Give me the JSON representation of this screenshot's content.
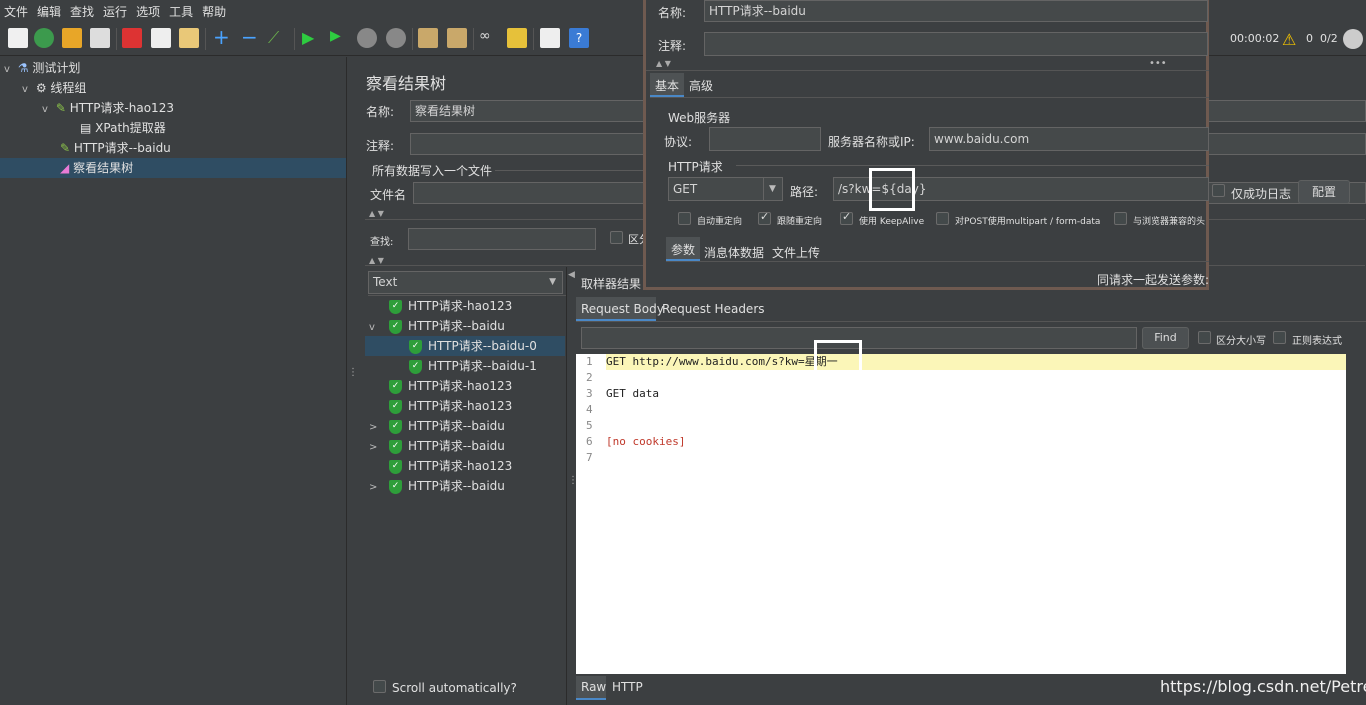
{
  "menu": [
    "文件",
    "编辑",
    "查找",
    "运行",
    "选项",
    "工具",
    "帮助"
  ],
  "status": {
    "elapsed": "00:00:02",
    "warnings": "0",
    "threads": "0/2"
  },
  "tree": {
    "items": [
      {
        "label": "测试计划",
        "icon": "flask-icon"
      },
      {
        "label": "线程组",
        "icon": "gear-icon"
      },
      {
        "label": "HTTP请求-hao123",
        "icon": "sampler-pen-icon"
      },
      {
        "label": "XPath提取器",
        "icon": "extractor-doc-icon"
      },
      {
        "label": "HTTP请求--baidu",
        "icon": "sampler-pen-icon"
      },
      {
        "label": "察看结果树",
        "icon": "chart-listener-icon"
      }
    ]
  },
  "listener": {
    "title": "察看结果树",
    "name_label": "名称:",
    "name_value": "察看结果树",
    "comment_label": "注释:",
    "file_group": "所有数据写入一个文件",
    "file_label": "文件名",
    "search_label": "查找:",
    "case_label": "区分",
    "renderer": "Text",
    "sampler_result_tab": "取样器结果",
    "scroll_auto": "Scroll automatically?"
  },
  "results": [
    {
      "label": "HTTP请求-hao123",
      "chev": ""
    },
    {
      "label": "HTTP请求--baidu",
      "chev": "v"
    },
    {
      "label": "HTTP请求--baidu-0",
      "chev": ""
    },
    {
      "label": "HTTP请求--baidu-1",
      "chev": ""
    },
    {
      "label": "HTTP请求-hao123",
      "chev": ""
    },
    {
      "label": "HTTP请求-hao123",
      "chev": ""
    },
    {
      "label": "HTTP请求--baidu",
      "chev": ">"
    },
    {
      "label": "HTTP请求--baidu",
      "chev": ">"
    },
    {
      "label": "HTTP请求-hao123",
      "chev": ""
    },
    {
      "label": "HTTP请求--baidu",
      "chev": ">"
    }
  ],
  "request_panel": {
    "tabs": [
      "Request Body",
      "Request Headers"
    ],
    "find_button": "Find",
    "case_label": "区分大小写",
    "regex_label": "正则表达式",
    "line_numbers": [
      "1",
      "2",
      "3",
      "4",
      "5",
      "6",
      "7"
    ],
    "lines": [
      "GET http://www.baidu.com/s?kw=星期一",
      "",
      "GET data",
      "",
      "",
      "[no cookies]",
      ""
    ],
    "bottom_tabs": [
      "Raw",
      "HTTP"
    ]
  },
  "dialog": {
    "name_label": "名称:",
    "name_value": "HTTP请求--baidu",
    "comment_label": "注释:",
    "tabs": [
      "基本",
      "高级"
    ],
    "web_server": "Web服务器",
    "protocol_label": "协议:",
    "server_label": "服务器名称或IP:",
    "server_value": "www.baidu.com",
    "http_request": "HTTP请求",
    "method": "GET",
    "path_label": "路径:",
    "path_value": "/s?kw=${day}",
    "options": [
      "自动重定向",
      "跟随重定向",
      "使用 KeepAlive",
      "对POST使用multipart / form-data",
      "与浏览器兼容的头"
    ],
    "options_checked": [
      false,
      true,
      true,
      false,
      false
    ],
    "success_log": "仅成功日志",
    "config_button": "配置",
    "param_tabs": [
      "参数",
      "消息体数据",
      "文件上传"
    ],
    "send_params": "同请求一起发送参数:"
  },
  "watermark": "https://blog.csdn.net/Petrel_"
}
